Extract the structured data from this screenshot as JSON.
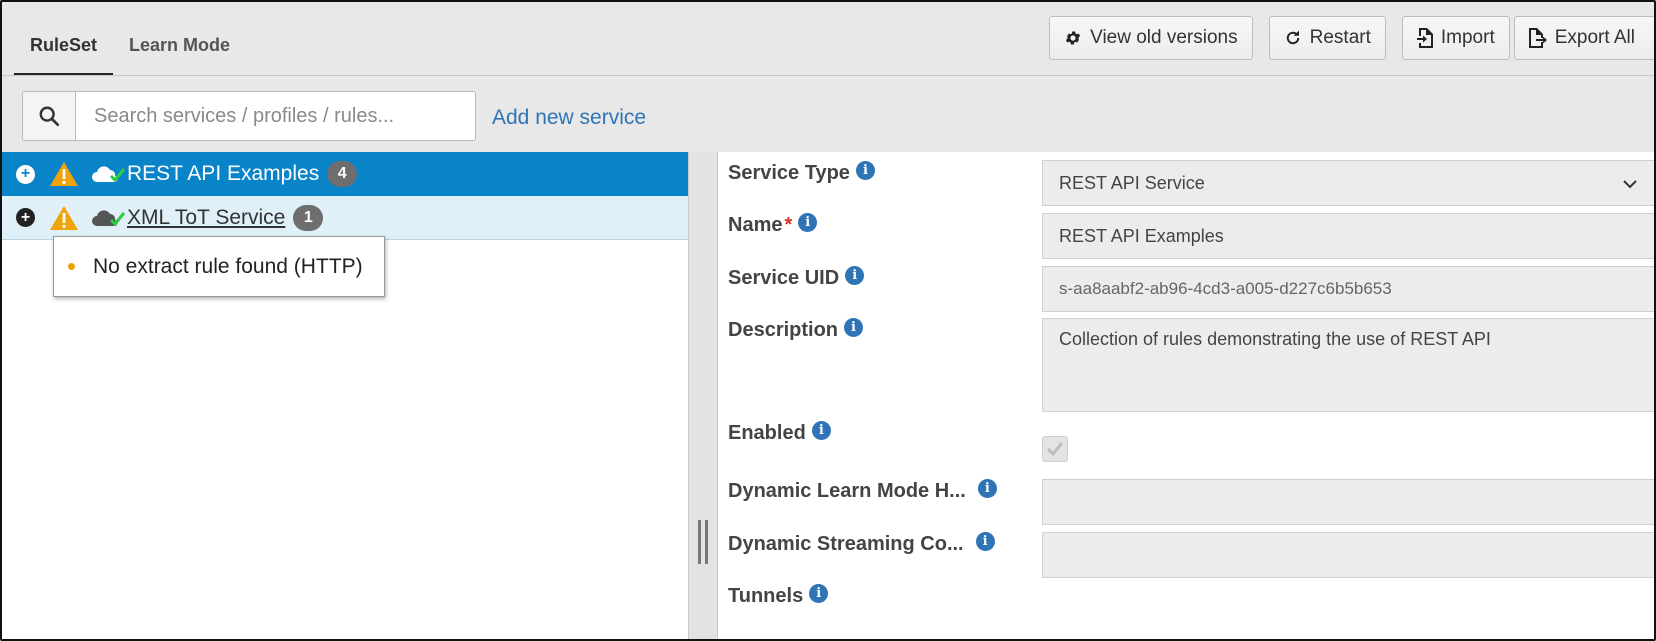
{
  "tabs": [
    {
      "label": "RuleSet",
      "active": true
    },
    {
      "label": "Learn Mode",
      "active": false
    }
  ],
  "toolbar": {
    "view_old_versions": "View old versions",
    "restart": "Restart",
    "import": "Import",
    "export_all": "Export All"
  },
  "search": {
    "placeholder": "Search services / profiles / rules...",
    "value": ""
  },
  "add_new_service": "Add new service",
  "services": [
    {
      "name": "REST API Examples",
      "count": "4",
      "selected": true,
      "icon_expander": "plus-circle-icon",
      "icon_warning": "warning-icon",
      "icon_status": "cloud-check-icon"
    },
    {
      "name": "XML ToT Service",
      "count": "1",
      "selected": false,
      "icon_expander": "plus-circle-icon",
      "icon_warning": "warning-icon",
      "icon_status": "cloud-check-icon"
    }
  ],
  "tooltip": {
    "text": "No extract rule found (HTTP)"
  },
  "form": {
    "service_type": {
      "label": "Service Type",
      "value": "REST API Service"
    },
    "name": {
      "label": "Name",
      "required_mark": "*",
      "value": "REST API Examples"
    },
    "service_uid": {
      "label": "Service UID",
      "value": "s-aa8aabf2-ab96-4cd3-a005-d227c6b5b653"
    },
    "description": {
      "label": "Description",
      "value": "Collection of rules demonstrating the use of REST API"
    },
    "enabled": {
      "label": "Enabled",
      "checked": true
    },
    "dynamic_learn_mode": {
      "label": "Dynamic Learn Mode H...",
      "value": ""
    },
    "dynamic_streaming": {
      "label": "Dynamic Streaming Co...",
      "value": ""
    },
    "tunnels": {
      "label": "Tunnels"
    }
  },
  "colors": {
    "selected_row": "#0a84c8",
    "hover_row": "#dff0f8",
    "link": "#2f74b5",
    "warning": "#f0a30a",
    "check_green": "#2ecc40",
    "badge": "#6e6e6e",
    "required": "#d9302c"
  }
}
